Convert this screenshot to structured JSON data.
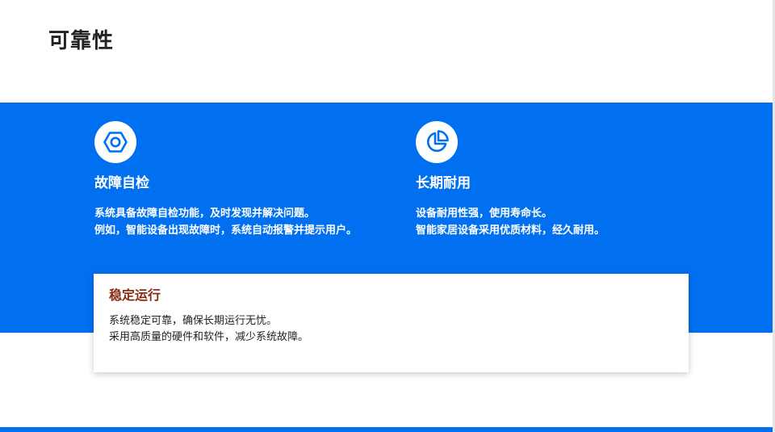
{
  "page": {
    "title": "可靠性"
  },
  "colors": {
    "accent_blue": "#0070f0",
    "card_title": "#8b2c14",
    "title_text": "#222222"
  },
  "features": [
    {
      "icon": "hexagon-nut-icon",
      "title": "故障自检",
      "lines": [
        "系统具备故障自检功能，及时发现并解决问题。",
        "例如，智能设备出现故障时，系统自动报警并提示用户。"
      ]
    },
    {
      "icon": "pie-chart-icon",
      "title": "长期耐用",
      "lines": [
        "设备耐用性强，使用寿命长。",
        "智能家居设备采用优质材料，经久耐用。"
      ]
    }
  ],
  "card": {
    "title": "稳定运行",
    "lines": [
      "系统稳定可靠，确保长期运行无忧。",
      "采用高质量的硬件和软件，减少系统故障。"
    ]
  }
}
